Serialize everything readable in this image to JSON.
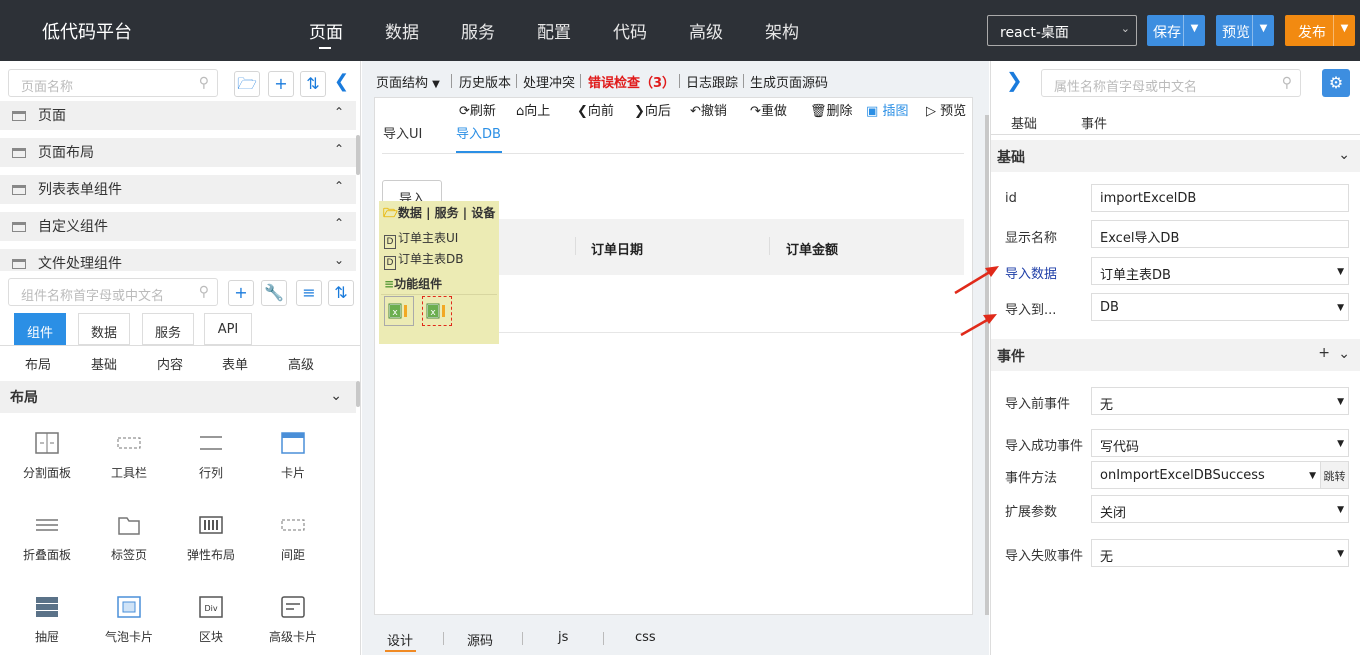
{
  "header": {
    "app_title": "低代码平台",
    "nav": [
      "页面",
      "数据",
      "服务",
      "配置",
      "代码",
      "高级",
      "架构"
    ],
    "platform_select": "react-桌面",
    "save": "保存",
    "preview": "预览",
    "publish": "发布",
    "colors": {
      "bar": "#2d3137",
      "save": "#3d8ee0",
      "preview": "#3d8ee0",
      "publish": "#f28a11"
    }
  },
  "left": {
    "page_search_placeholder": "页面名称",
    "tree": [
      "页面",
      "页面布局",
      "列表表单组件",
      "自定义组件",
      "文件处理组件"
    ],
    "comp_search_placeholder": "组件名称首字母或中文名",
    "tabs": [
      "组件",
      "数据",
      "服务",
      "API"
    ],
    "subtabs": [
      "布局",
      "基础",
      "内容",
      "表单",
      "高级"
    ],
    "section": "布局",
    "components": [
      "分割面板",
      "工具栏",
      "行列",
      "卡片",
      "折叠面板",
      "标签页",
      "弹性布局",
      "间距",
      "抽屉",
      "气泡卡片",
      "区块",
      "高级卡片"
    ]
  },
  "center": {
    "toolbar": [
      "页面结构",
      "历史版本",
      "处理冲突",
      "错误检查（3）",
      "日志跟踪",
      "生成页面源码"
    ],
    "actions": [
      "刷新",
      "向上",
      "向前",
      "向后",
      "撤销",
      "重做",
      "删除",
      "插图",
      "预览"
    ],
    "tabs": [
      "导入UI",
      "导入DB"
    ],
    "import_button": "导入",
    "columns": [
      "订单日期",
      "订单金额"
    ],
    "popup": {
      "header": "数据 | 服务 | 设备",
      "items": [
        "订单主表UI",
        "订单主表DB"
      ],
      "group": "功能组件"
    },
    "bottom_tabs": [
      "设计",
      "源码",
      "js",
      "css"
    ]
  },
  "right": {
    "search_placeholder": "属性名称首字母或中文名",
    "tabs": [
      "基础",
      "事件"
    ],
    "basic_section": "基础",
    "props": [
      {
        "label": "id",
        "value": "importExcelDB"
      },
      {
        "label": "显示名称",
        "value": "Excel导入DB"
      },
      {
        "label": "导入数据",
        "value": "订单主表DB"
      },
      {
        "label": "导入到...",
        "value": "DB"
      }
    ],
    "event_section": "事件",
    "events": [
      {
        "label": "导入前事件",
        "value": "无"
      },
      {
        "label": "导入成功事件",
        "value": "写代码"
      },
      {
        "label": "事件方法",
        "value": "onImportExcelDBSuccess"
      },
      {
        "label": "扩展参数",
        "value": "关闭"
      },
      {
        "label": "导入失败事件",
        "value": "无"
      }
    ],
    "jump_label": "跳转"
  }
}
